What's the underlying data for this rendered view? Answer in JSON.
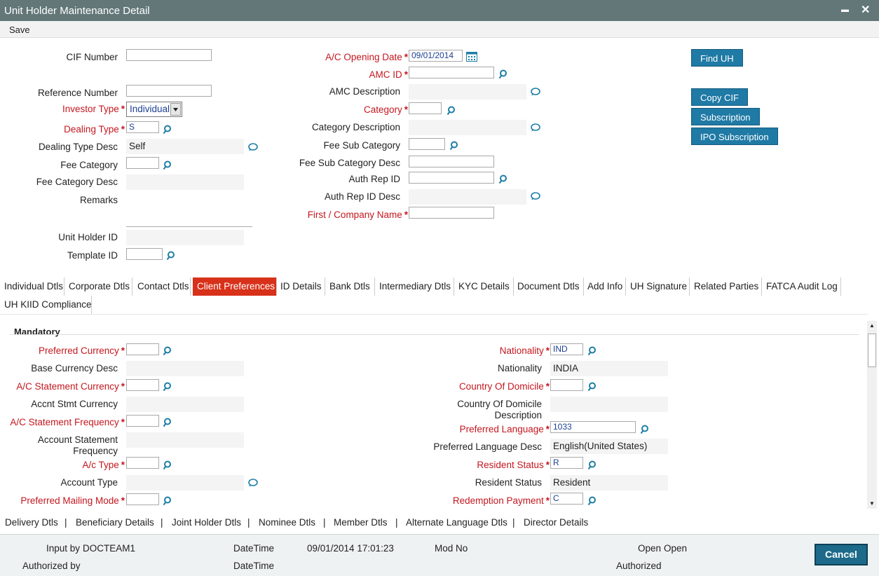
{
  "window": {
    "title": "Unit Holder Maintenance Detail",
    "minimize": "▬",
    "close": "✕"
  },
  "toolbar": {
    "save": "Save"
  },
  "header": {
    "cif_number": "CIF Number",
    "reference_number": "Reference Number",
    "investor_type": "Investor Type",
    "investor_type_value": "Individual",
    "dealing_type": "Dealing Type",
    "dealing_type_value": "S",
    "dealing_type_desc": "Dealing Type Desc",
    "dealing_type_desc_value": "Self",
    "fee_category": "Fee Category",
    "fee_category_desc": "Fee Category Desc",
    "remarks": "Remarks",
    "unit_holder_id": "Unit Holder ID",
    "template_id": "Template ID",
    "ac_opening_date": "A/C Opening Date",
    "ac_opening_date_value": "09/01/2014",
    "amc_id": "AMC ID",
    "amc_description": "AMC Description",
    "category": "Category",
    "category_description": "Category Description",
    "fee_sub_category": "Fee Sub Category",
    "fee_sub_category_desc": "Fee Sub Category Desc",
    "auth_rep_id": "Auth Rep ID",
    "auth_rep_id_desc": "Auth Rep ID Desc",
    "first_company_name": "First / Company Name"
  },
  "buttons": {
    "find_uh": "Find UH",
    "copy_cif": "Copy CIF",
    "subscription": "Subscription",
    "ipo_subscription": "IPO Subscription"
  },
  "tabs": [
    "Individual Dtls",
    "Corporate Dtls",
    "Contact Dtls",
    "Client Preferences",
    "ID Details",
    "Bank Dtls",
    "Intermediary Dtls",
    "KYC Details",
    "Document Dtls",
    "Add Info",
    "UH Signature",
    "Related Parties",
    "FATCA Audit Log",
    "UH KIID Compliance"
  ],
  "active_tab": "Client Preferences",
  "section": {
    "mandatory": "Mandatory"
  },
  "prefs": {
    "preferred_currency": "Preferred Currency",
    "base_currency_desc": "Base Currency Desc",
    "ac_statement_currency": "A/C Statement Currency",
    "accnt_stmt_currency": "Accnt Stmt Currency",
    "ac_statement_frequency": "A/C Statement Frequency",
    "account_statement_frequency_1": "Account Statement",
    "account_statement_frequency_2": "Frequency",
    "ac_type": "A/c Type",
    "account_type": "Account Type",
    "preferred_mailing_mode": "Preferred Mailing Mode",
    "nationality_req": "Nationality",
    "nationality_value": "IND",
    "nationality": "Nationality",
    "nationality_desc": "INDIA",
    "country_of_domicile": "Country Of Domicile",
    "country_of_domicile_desc_1": "Country Of Domicile",
    "country_of_domicile_desc_2": "Description",
    "preferred_language": "Preferred Language",
    "preferred_language_value": "1033",
    "preferred_language_desc": "Preferred Language Desc",
    "preferred_language_desc_value": "English(United States)",
    "resident_status_req": "Resident Status",
    "resident_status_value": "R",
    "resident_status": "Resident Status",
    "resident_status_desc": "Resident",
    "redemption_payment": "Redemption Payment",
    "redemption_payment_value": "C"
  },
  "subtabs": [
    "Delivery Dtls",
    "|",
    "Beneficiary Details",
    "|",
    "Joint Holder Dtls",
    "|",
    "Nominee Dtls",
    "|",
    "Member Dtls",
    "|",
    "Alternate Language Dtls",
    "|",
    "Director Details"
  ],
  "footer": {
    "input_by": "Input by",
    "input_by_value": "DOCTEAM1",
    "datetime": "DateTime",
    "datetime_value": "09/01/2014 17:01:23",
    "mod_no": "Mod No",
    "open": "Open",
    "open_value": "Open",
    "authorized_by": "Authorized by",
    "datetime2": "DateTime",
    "authorized": "Authorized",
    "cancel": "Cancel"
  }
}
